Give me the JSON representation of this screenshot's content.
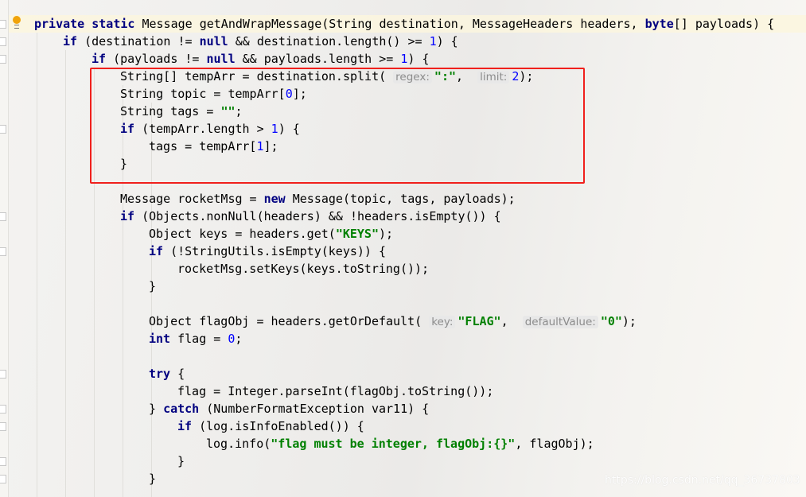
{
  "colors": {
    "keyword": "#000080",
    "number": "#0000ff",
    "string": "#008000",
    "hint": "#8c8c8c",
    "highlight_box": "#f0201c",
    "current_line": "#fcf6de"
  },
  "gutter_icons": [
    "intention-bulb-icon",
    "fold-marker-icon"
  ],
  "watermark": "https://blog.csdn.net/qq_36737803",
  "code_lines": [
    {
      "indent": 0,
      "tokens": [
        [
          "kw",
          "private static"
        ],
        [
          "t",
          " Message getAndWrapMessage(String destination, MessageHeaders headers, "
        ],
        [
          "kw",
          "byte"
        ],
        [
          "t",
          "[] payloads) {"
        ]
      ]
    },
    {
      "indent": 1,
      "tokens": [
        [
          "kw",
          "if"
        ],
        [
          "t",
          " (destination != "
        ],
        [
          "kw",
          "null"
        ],
        [
          "t",
          " && destination.length() >= "
        ],
        [
          "num",
          "1"
        ],
        [
          "t",
          ") {"
        ]
      ]
    },
    {
      "indent": 2,
      "tokens": [
        [
          "kw",
          "if"
        ],
        [
          "t",
          " (payloads != "
        ],
        [
          "kw",
          "null"
        ],
        [
          "t",
          " && payloads.length >= "
        ],
        [
          "num",
          "1"
        ],
        [
          "t",
          ") {"
        ]
      ]
    },
    {
      "indent": 3,
      "tokens": [
        [
          "t",
          "String[] tempArr = destination.split( "
        ],
        [
          "hint",
          "regex:"
        ],
        [
          "str",
          "\":\""
        ],
        [
          "t",
          ",  "
        ],
        [
          "hint",
          "limit:"
        ],
        [
          "num",
          "2"
        ],
        [
          "t",
          ");"
        ]
      ]
    },
    {
      "indent": 3,
      "tokens": [
        [
          "t",
          "String topic = tempArr["
        ],
        [
          "num",
          "0"
        ],
        [
          "t",
          "];"
        ]
      ]
    },
    {
      "indent": 3,
      "tokens": [
        [
          "t",
          "String tags = "
        ],
        [
          "str",
          "\"\""
        ],
        [
          "t",
          ";"
        ]
      ]
    },
    {
      "indent": 3,
      "tokens": [
        [
          "kw",
          "if"
        ],
        [
          "t",
          " (tempArr.length > "
        ],
        [
          "num",
          "1"
        ],
        [
          "t",
          ") {"
        ]
      ]
    },
    {
      "indent": 4,
      "tokens": [
        [
          "t",
          "tags = tempArr["
        ],
        [
          "num",
          "1"
        ],
        [
          "t",
          "];"
        ]
      ]
    },
    {
      "indent": 3,
      "tokens": [
        [
          "t",
          "}"
        ]
      ]
    },
    {
      "indent": 0,
      "tokens": []
    },
    {
      "indent": 3,
      "tokens": [
        [
          "t",
          "Message rocketMsg = "
        ],
        [
          "kw",
          "new"
        ],
        [
          "t",
          " Message(topic, tags, payloads);"
        ]
      ]
    },
    {
      "indent": 3,
      "tokens": [
        [
          "kw",
          "if"
        ],
        [
          "t",
          " (Objects.nonNull(headers) && !headers.isEmpty()) {"
        ]
      ]
    },
    {
      "indent": 4,
      "tokens": [
        [
          "t",
          "Object keys = headers.get("
        ],
        [
          "str",
          "\"KEYS\""
        ],
        [
          "t",
          ");"
        ]
      ]
    },
    {
      "indent": 4,
      "tokens": [
        [
          "kw",
          "if"
        ],
        [
          "t",
          " (!StringUtils.isEmpty(keys)) {"
        ]
      ]
    },
    {
      "indent": 5,
      "tokens": [
        [
          "t",
          "rocketMsg.setKeys(keys.toString());"
        ]
      ]
    },
    {
      "indent": 4,
      "tokens": [
        [
          "t",
          "}"
        ]
      ]
    },
    {
      "indent": 0,
      "tokens": []
    },
    {
      "indent": 4,
      "tokens": [
        [
          "t",
          "Object flagObj = headers.getOrDefault( "
        ],
        [
          "hint",
          "key:"
        ],
        [
          "str",
          "\"FLAG\""
        ],
        [
          "t",
          ",  "
        ],
        [
          "hint",
          "defaultValue:"
        ],
        [
          "str",
          "\"0\""
        ],
        [
          "t",
          ");"
        ]
      ]
    },
    {
      "indent": 4,
      "tokens": [
        [
          "kw",
          "int"
        ],
        [
          "t",
          " flag = "
        ],
        [
          "num",
          "0"
        ],
        [
          "t",
          ";"
        ]
      ]
    },
    {
      "indent": 0,
      "tokens": []
    },
    {
      "indent": 4,
      "tokens": [
        [
          "kw",
          "try"
        ],
        [
          "t",
          " {"
        ]
      ]
    },
    {
      "indent": 5,
      "tokens": [
        [
          "t",
          "flag = Integer.parseInt(flagObj.toString());"
        ]
      ]
    },
    {
      "indent": 4,
      "tokens": [
        [
          "t",
          "} "
        ],
        [
          "kw",
          "catch"
        ],
        [
          "t",
          " (NumberFormatException var11) {"
        ]
      ]
    },
    {
      "indent": 5,
      "tokens": [
        [
          "kw",
          "if"
        ],
        [
          "t",
          " (log.isInfoEnabled()) {"
        ]
      ]
    },
    {
      "indent": 6,
      "tokens": [
        [
          "t",
          "log.info("
        ],
        [
          "str",
          "\"flag must be integer, flagObj:{}\""
        ],
        [
          "t",
          ", flagObj);"
        ]
      ]
    },
    {
      "indent": 5,
      "tokens": [
        [
          "t",
          "}"
        ]
      ]
    },
    {
      "indent": 4,
      "tokens": [
        [
          "t",
          "}"
        ]
      ]
    }
  ]
}
